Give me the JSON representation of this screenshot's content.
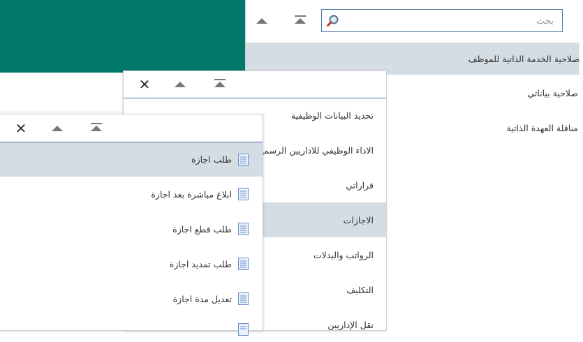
{
  "search": {
    "placeholder": "بحث"
  },
  "panel1": {
    "items": [
      {
        "label": "صلاحية الخدمة الذاتية للموظف",
        "active": true
      },
      {
        "label": "صلاحية بياناتي"
      },
      {
        "label": "مناقلة العهدة الذاتية"
      }
    ]
  },
  "panel2": {
    "items": [
      {
        "label": "تحديد البيانات الوظيفية"
      },
      {
        "label": "الاداء الوظيفي للاداريين الرسميين"
      },
      {
        "label": "قراراتي"
      },
      {
        "label": "الاجازات",
        "active": true
      },
      {
        "label": "الرواتب والبدلات"
      },
      {
        "label": "التكليف"
      },
      {
        "label": "نقل الإداريين"
      }
    ]
  },
  "panel3": {
    "items": [
      {
        "label": "طلب اجازة",
        "icon": "document-icon",
        "active": true
      },
      {
        "label": "ابلاغ مباشرة بعد اجازة",
        "icon": "document-icon"
      },
      {
        "label": "طلب قطع اجازة",
        "icon": "document-icon"
      },
      {
        "label": "طلب تمديد اجازة",
        "icon": "document-icon"
      },
      {
        "label": "تعديل مدة اجازة",
        "icon": "document-icon"
      }
    ]
  },
  "colors": {
    "header": "#00796b",
    "active_row": "#d5dde4",
    "accent_border": "#4a78a8"
  }
}
